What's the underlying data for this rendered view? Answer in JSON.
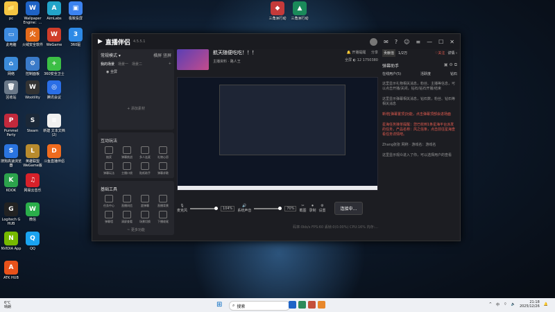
{
  "desktop_icons": [
    {
      "label": "pc",
      "color": "#f5c542",
      "glyph": "📁"
    },
    {
      "label": "Wallpaper Engine：...",
      "color": "#1e63c6",
      "glyph": "W"
    },
    {
      "label": "AimLabs",
      "color": "#22a4c9",
      "glyph": "A"
    },
    {
      "label": "极致投屏",
      "color": "#3c83f0",
      "glyph": "▣"
    },
    {
      "label": "此电脑",
      "color": "#3d8be0",
      "glyph": "▭"
    },
    {
      "label": "火绒安全软件",
      "color": "#e46a1b",
      "glyph": "火"
    },
    {
      "label": "WeGame",
      "color": "#d03d2a",
      "glyph": "W"
    },
    {
      "label": "360驱",
      "color": "#2e8ae6",
      "glyph": "3"
    },
    {
      "label": "网络",
      "color": "#3b8ad8",
      "glyph": "⌂"
    },
    {
      "label": "控制面板",
      "color": "#3a7ac8",
      "glyph": "⚙"
    },
    {
      "label": "360安全卫士",
      "color": "#3cbf45",
      "glyph": "+"
    },
    {
      "label": "回收站",
      "color": "#6a7888",
      "glyph": "🗑"
    },
    {
      "label": "Wootility",
      "color": "#333",
      "glyph": "W"
    },
    {
      "label": "腾讯会议",
      "color": "#2a6ee6",
      "glyph": "◎"
    },
    {
      "label": "Pummel Party",
      "color": "#c2293c",
      "glyph": "P"
    },
    {
      "label": "Steam",
      "color": "#1b2838",
      "glyph": "S"
    },
    {
      "label": "新建 文本文档 (2)",
      "color": "#f0f0f0",
      "glyph": "≡"
    },
    {
      "label": "搜狗高速浏览器",
      "color": "#2a74e0",
      "glyph": "S"
    },
    {
      "label": "英雄联盟WeGame版",
      "color": "#b88b2e",
      "glyph": "L"
    },
    {
      "label": "斗鱼直播伴侣",
      "color": "#ef6b1e",
      "glyph": "D"
    },
    {
      "label": "KOOK",
      "color": "#2ca34c",
      "glyph": "K"
    },
    {
      "label": "网易云音乐",
      "color": "#d8212a",
      "glyph": "♫"
    },
    {
      "label": "Logitech G HUB",
      "color": "#222",
      "glyph": "G"
    },
    {
      "label": "微信",
      "color": "#2aae4a",
      "glyph": "W"
    },
    {
      "label": "NVIDIA App",
      "color": "#76b900",
      "glyph": "N"
    },
    {
      "label": "QQ",
      "color": "#1aa3f0",
      "glyph": "Q"
    },
    {
      "label": "ATK HUB",
      "color": "#e8521a",
      "glyph": "A"
    }
  ],
  "top_icons": [
    {
      "label": "三角洲行动",
      "color": "#c43a3a"
    },
    {
      "label": "三角洲行动",
      "color": "#1a8a5a"
    }
  ],
  "app": {
    "title": "直播伴侣",
    "version": "4.5.5.1",
    "mode_label": "常规模式 ▾",
    "mode_right": "横屏 竖屏",
    "scene_tabs": [
      "我的场景",
      "场景一",
      "场景二"
    ],
    "source_item": "全屏",
    "add_source": "+ 添加素材",
    "interact_title": "互动玩法",
    "interact_tools": [
      "抽奖",
      "弹幕挑战",
      "多人连麦",
      "礼物心愿",
      "弹幕玩法",
      "主播口袋",
      "贴纸助手",
      "弹幕求歌"
    ],
    "basic_title": "基础工具",
    "basic_tools": [
      "任务中心",
      "直播间信",
      "超弹幕",
      "直播背景",
      "弹幕墙",
      "清屏查看",
      "场景切换",
      "下播收尾"
    ],
    "more": "~ 更多功能",
    "stream_title": "航天随便吃吃！！！",
    "stream_cat": "主播资料 · 路人王",
    "live_notice": "开播提醒",
    "share": "分享",
    "fullscreen": "全屏",
    "viewers": "12",
    "id": "1750380",
    "mic_label": "麦克风",
    "mic_pct": "104%",
    "sys_label": "系统声音",
    "sys_pct": "70%",
    "ctrl_btns": [
      "截图",
      "录制",
      "设置"
    ],
    "live_btn": "连接中...",
    "stats": "码率:0kb/s   FPS:60   丢帧:0(0.00%)   CPU:16%   内存:..."
  },
  "right_panel": {
    "contrib": "贡献值",
    "count": "1/2万",
    "follow": "♡关注",
    "detail": "详情 ›",
    "danmu_title": "弹幕助手",
    "tabs": [
      "在线用户(5)",
      "活跃度",
      "钻石"
    ],
    "msgs": [
      {
        "text": "这里显示礼物相关消息，粉丝、主播等信息，可以点击开播/关闭，钻石/钻石开播/结束",
        "hi": false
      },
      {
        "text": "这里显示弹幕相关消息，钻石数，粉丝、钻石等相关消息",
        "hi": false
      },
      {
        "text": "新增[弹幕置顶]功能，点击弹幕顶部会进场面",
        "hi": true
      },
      {
        "text": "星海任务接单提醒：您已收到1条星海平台派发的任务，产品名称：风之信条，点击前往星海查看任务详情吧。",
        "hi": true
      },
      {
        "text": "Zhang张张 网称 · 游戏名：游戏名",
        "hi": false
      },
      {
        "text": "这里显示观众进入了你，可以选择用户的查看",
        "hi": false
      }
    ]
  },
  "taskbar": {
    "weather_temp": "6°C",
    "weather_desc": "晴朗",
    "search_placeholder": "搜索",
    "lang": "中",
    "time": "21:18",
    "date": "2025/12/26"
  }
}
